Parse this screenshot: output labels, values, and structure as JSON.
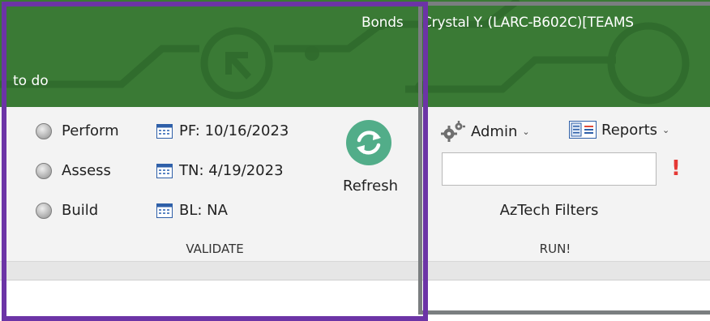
{
  "header": {
    "user_before": "Bonds",
    "user_name": "Crystal Y. (LARC-B602C)[TEAMS",
    "todo_text": "to do"
  },
  "validate": {
    "radios": [
      {
        "label": "Perform"
      },
      {
        "label": "Assess"
      },
      {
        "label": "Build"
      }
    ],
    "dates": [
      {
        "label": "PF: 10/16/2023"
      },
      {
        "label": "TN: 4/19/2023"
      },
      {
        "label": "BL: NA"
      }
    ],
    "refresh_label": "Refresh",
    "group_label": "VALIDATE"
  },
  "run": {
    "admin_label": "Admin",
    "reports_label": "Reports",
    "search_value": "",
    "alert_mark": "!",
    "filters_label": "AzTech Filters",
    "group_label": "RUN!"
  },
  "colors": {
    "header_green": "#3a7a35",
    "refresh_green": "#52ad89",
    "alert_red": "#e53935",
    "frame_purple": "#6c34a6",
    "frame_grey": "#7a7e80"
  }
}
